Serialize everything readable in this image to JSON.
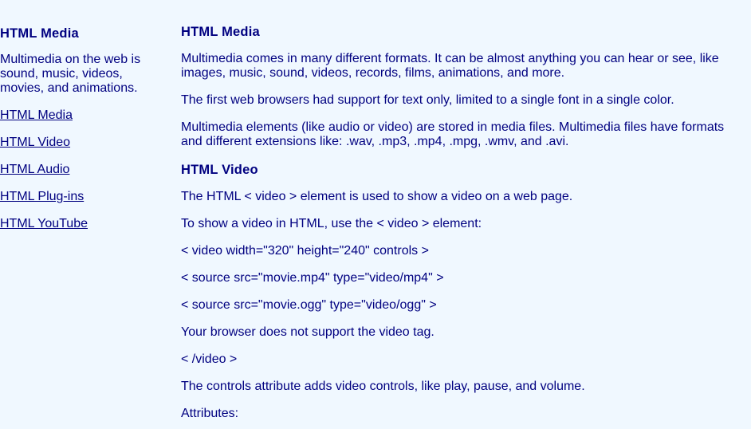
{
  "sidebar": {
    "title": "HTML Media",
    "intro": "Multimedia on the web is sound, music, videos, movies, and animations.",
    "links": [
      "HTML Media",
      "HTML Video",
      "HTML Audio",
      "HTML Plug-ins",
      "HTML YouTube"
    ]
  },
  "main": {
    "section1": {
      "title": "HTML Media",
      "paragraphs": [
        "Multimedia comes in many different formats. It can be almost anything you can hear or see, like images, music, sound, videos, records, films, animations, and more.",
        "The first web browsers had support for text only, limited to a single font in a single color.",
        "Multimedia elements (like audio or video) are stored in media files. Multimedia files have formats and different extensions like: .wav, .mp3, .mp4, .mpg, .wmv, and .avi."
      ]
    },
    "section2": {
      "title": "HTML Video",
      "paragraphs": [
        "The HTML < video > element is used to show a video on a web page.",
        "To show a video in HTML, use the < video > element:",
        "< video width=\"320\" height=\"240\" controls >",
        "< source src=\"movie.mp4\" type=\"video/mp4\" >",
        "< source src=\"movie.ogg\" type=\"video/ogg\" >",
        "Your browser does not support the video tag.",
        "< /video >",
        "The controls attribute adds video controls, like play, pause, and volume.",
        "Attributes:"
      ]
    }
  }
}
